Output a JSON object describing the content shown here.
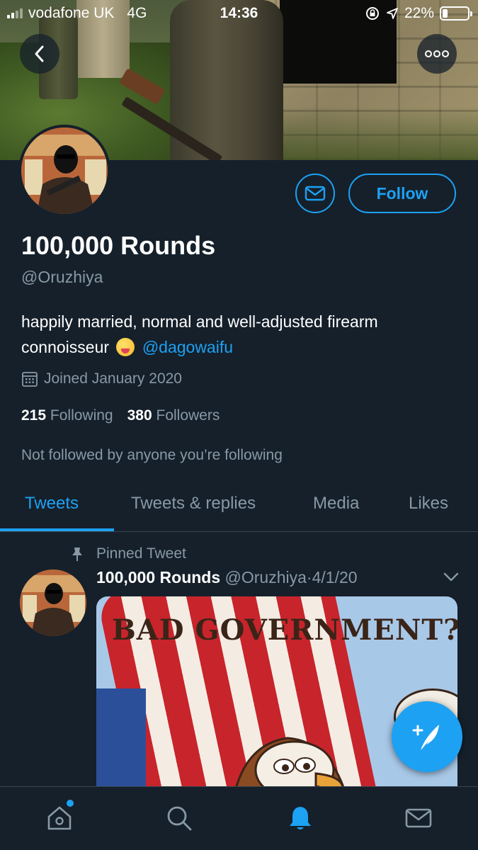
{
  "status_bar": {
    "carrier": "vodafone UK",
    "network": "4G",
    "time": "14:36",
    "battery": "22%",
    "battery_level": 0.22
  },
  "header": {
    "back_icon": "chevron-left-icon",
    "more_icon": "more-horizontal-icon"
  },
  "profile": {
    "display_name": "100,000 Rounds",
    "handle": "@Oruzhiya",
    "bio_text": "happily married, normal and well-adjusted firearm connoisseur",
    "bio_mention": "@dagowaifu",
    "joined": "Joined January 2020",
    "following_count": "215",
    "following_label": "Following",
    "followers_count": "380",
    "followers_label": "Followers",
    "not_followed_text": "Not followed by anyone you’re following",
    "follow_button": "Follow",
    "message_icon": "mail-icon"
  },
  "tabs": [
    {
      "label": "Tweets",
      "active": true
    },
    {
      "label": "Tweets & replies",
      "active": false
    },
    {
      "label": "Media",
      "active": false
    },
    {
      "label": "Likes",
      "active": false
    }
  ],
  "pinned_tweet": {
    "pinned_label": "Pinned Tweet",
    "author_name": "100,000 Rounds",
    "author_handle": "@Oruzhiya",
    "separator": "·",
    "date": "4/1/20",
    "media_text": "BAD GOVERNMENT?"
  },
  "fab": {
    "icon": "compose-tweet-icon"
  },
  "bottom_nav": [
    {
      "icon": "home-icon"
    },
    {
      "icon": "search-icon"
    },
    {
      "icon": "notifications-bell-icon",
      "active": true
    },
    {
      "icon": "messages-mail-icon"
    }
  ],
  "colors": {
    "background": "#15202b",
    "accent": "#1da1f2",
    "secondary_text": "#8899a6",
    "divider": "#38444d"
  }
}
